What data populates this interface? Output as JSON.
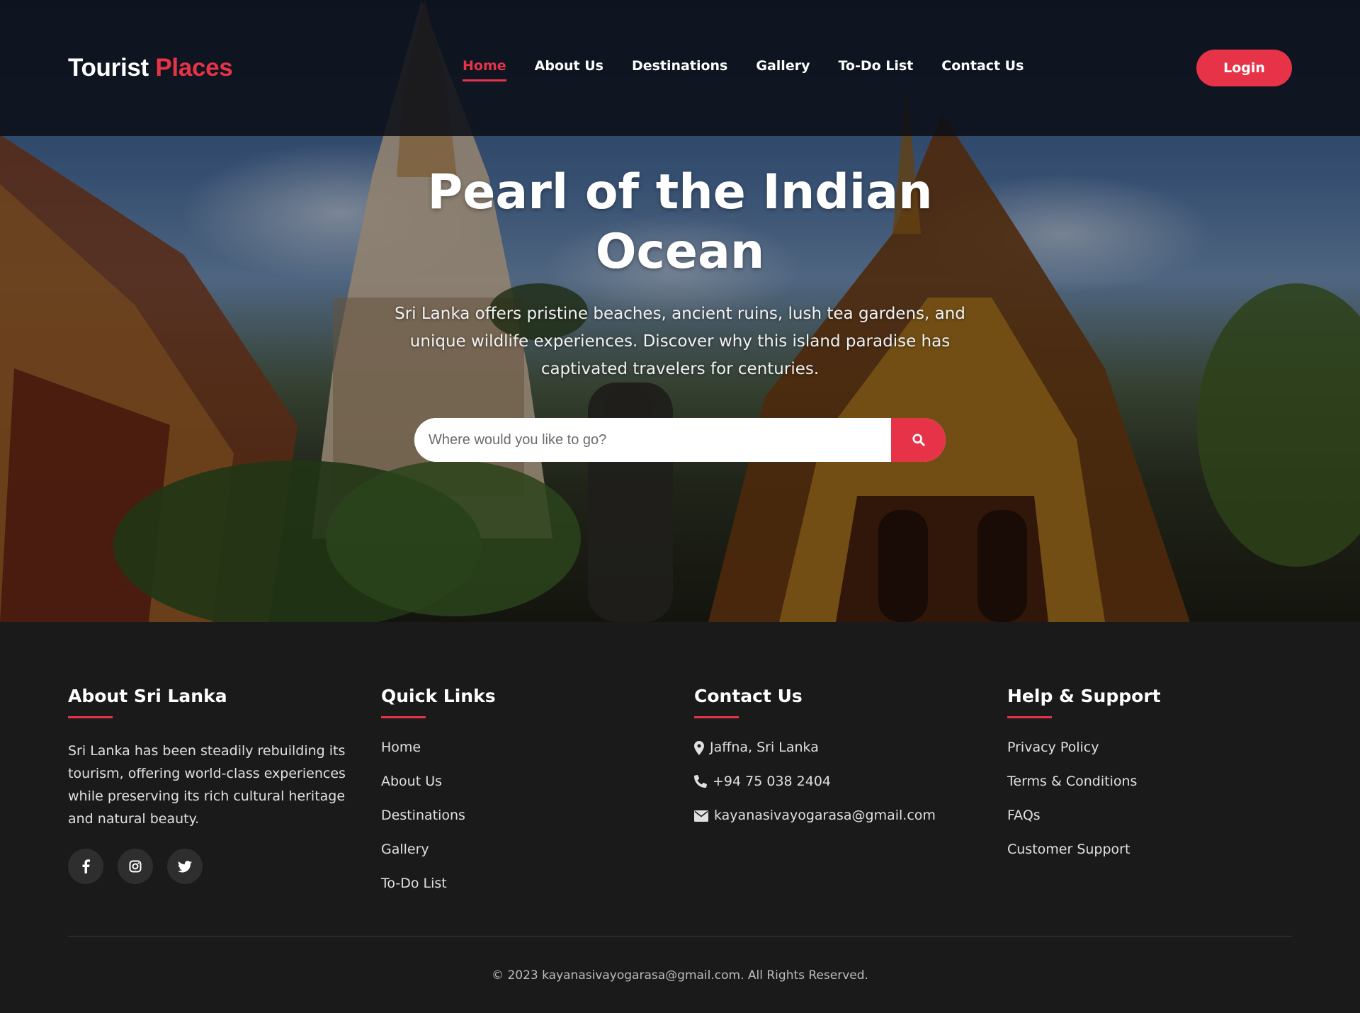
{
  "brand": {
    "name_first": "Tourist",
    "name_accent": "Places"
  },
  "nav": {
    "items": [
      {
        "label": "Home",
        "active": true
      },
      {
        "label": "About Us"
      },
      {
        "label": "Destinations"
      },
      {
        "label": "Gallery"
      },
      {
        "label": "To-Do List"
      },
      {
        "label": "Contact Us"
      }
    ],
    "login_label": "Login"
  },
  "hero": {
    "title": "Pearl of the Indian Ocean",
    "description": "Sri Lanka offers pristine beaches, ancient ruins, lush tea gardens, and unique wildlife experiences. Discover why this island paradise has captivated travelers for centuries.",
    "search_placeholder": "Where would you like to go?",
    "search_icon": "search-icon"
  },
  "footer": {
    "about": {
      "heading": "About Sri Lanka",
      "text": "Sri Lanka has been steadily rebuilding its tourism, offering world-class experiences while preserving its rich cultural heritage and natural beauty.",
      "social": [
        "facebook-icon",
        "instagram-icon",
        "twitter-icon"
      ]
    },
    "quick_links": {
      "heading": "Quick Links",
      "items": [
        "Home",
        "About Us",
        "Destinations",
        "Gallery",
        "To-Do List"
      ]
    },
    "contact": {
      "heading": "Contact Us",
      "address": "Jaffna, Sri Lanka",
      "phone": "+94 75 038 2404",
      "email": "kayanasivayogarasa@gmail.com"
    },
    "help": {
      "heading": "Help & Support",
      "items": [
        "Privacy Policy",
        "Terms & Conditions",
        "FAQs",
        "Customer Support"
      ]
    },
    "copyright": "© 2023 kayanasivayogarasa@gmail.com. All Rights Reserved."
  },
  "colors": {
    "accent": "#e63348",
    "footer_bg": "#1a1a1a",
    "header_bg": "#0a0e16"
  }
}
